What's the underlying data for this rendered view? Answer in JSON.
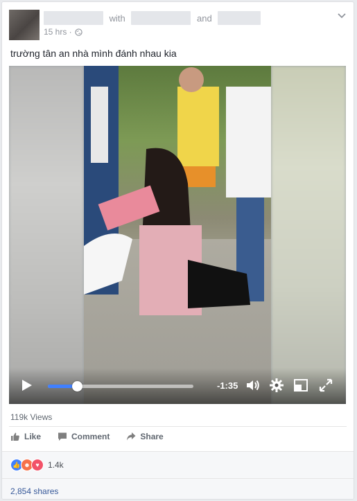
{
  "header": {
    "with_word": "with",
    "and_word": "and",
    "timestamp": "15 hrs ·"
  },
  "post": {
    "text": "trường tân an nhà mình đánh nhau kia"
  },
  "video": {
    "remaining_time": "-1:35",
    "progress_fraction": 0.2
  },
  "stats": {
    "views": "119k Views",
    "reaction_count": "1.4k",
    "shares": "2,854 shares"
  },
  "actions": {
    "like": "Like",
    "comment": "Comment",
    "share": "Share"
  },
  "colors": {
    "accent": "#4080ff",
    "link": "#365899",
    "love": "#f25268",
    "angry": "#f7714b"
  },
  "icons": [
    "globe-icon",
    "chevron-down-icon",
    "play-icon",
    "volume-icon",
    "gear-icon",
    "pip-icon",
    "fullscreen-icon",
    "like-icon",
    "comment-icon",
    "share-icon"
  ]
}
